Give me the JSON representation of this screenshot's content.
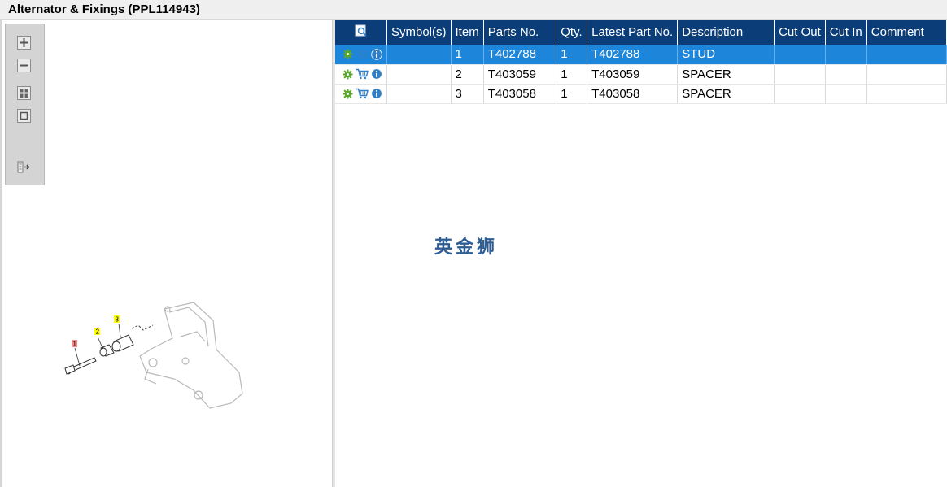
{
  "window": {
    "title": "Alternator & Fixings (PPL114943)"
  },
  "toolbar": {
    "buttons": [
      {
        "name": "zoom-in-icon"
      },
      {
        "name": "zoom-out-icon"
      },
      {
        "name": "fit-all-icon"
      },
      {
        "name": "fit-window-icon"
      },
      {
        "name": "export-icon"
      }
    ]
  },
  "diagram": {
    "callouts": [
      {
        "label": "1",
        "color": "#f28b8b"
      },
      {
        "label": "2",
        "color": "#ffff00"
      },
      {
        "label": "3",
        "color": "#ffff00"
      }
    ]
  },
  "table": {
    "columns": [
      "",
      "Symbol(s)",
      "Item",
      "Parts No.",
      "Qty.",
      "Latest Part No.",
      "Description",
      "Cut Out",
      "Cut In",
      "Comment"
    ],
    "rows": [
      {
        "symbols": "",
        "item": "1",
        "part_no": "T402788",
        "qty": "1",
        "latest_part_no": "T402788",
        "description": "STUD",
        "cut_out": "",
        "cut_in": "",
        "comment": ""
      },
      {
        "symbols": "",
        "item": "2",
        "part_no": "T403059",
        "qty": "1",
        "latest_part_no": "T403059",
        "description": "SPACER",
        "cut_out": "",
        "cut_in": "",
        "comment": ""
      },
      {
        "symbols": "",
        "item": "3",
        "part_no": "T403058",
        "qty": "1",
        "latest_part_no": "T403058",
        "description": "SPACER",
        "cut_out": "",
        "cut_in": "",
        "comment": ""
      }
    ],
    "selected_row": 0,
    "row_icons": [
      "gear-icon",
      "cart-icon",
      "info-icon"
    ]
  },
  "watermark": {
    "text": "英金狮"
  },
  "colors": {
    "header_bg": "#0b3e79",
    "selected_bg": "#1e86da",
    "gear": "#5aa82a",
    "info": "#2f7fc9"
  }
}
